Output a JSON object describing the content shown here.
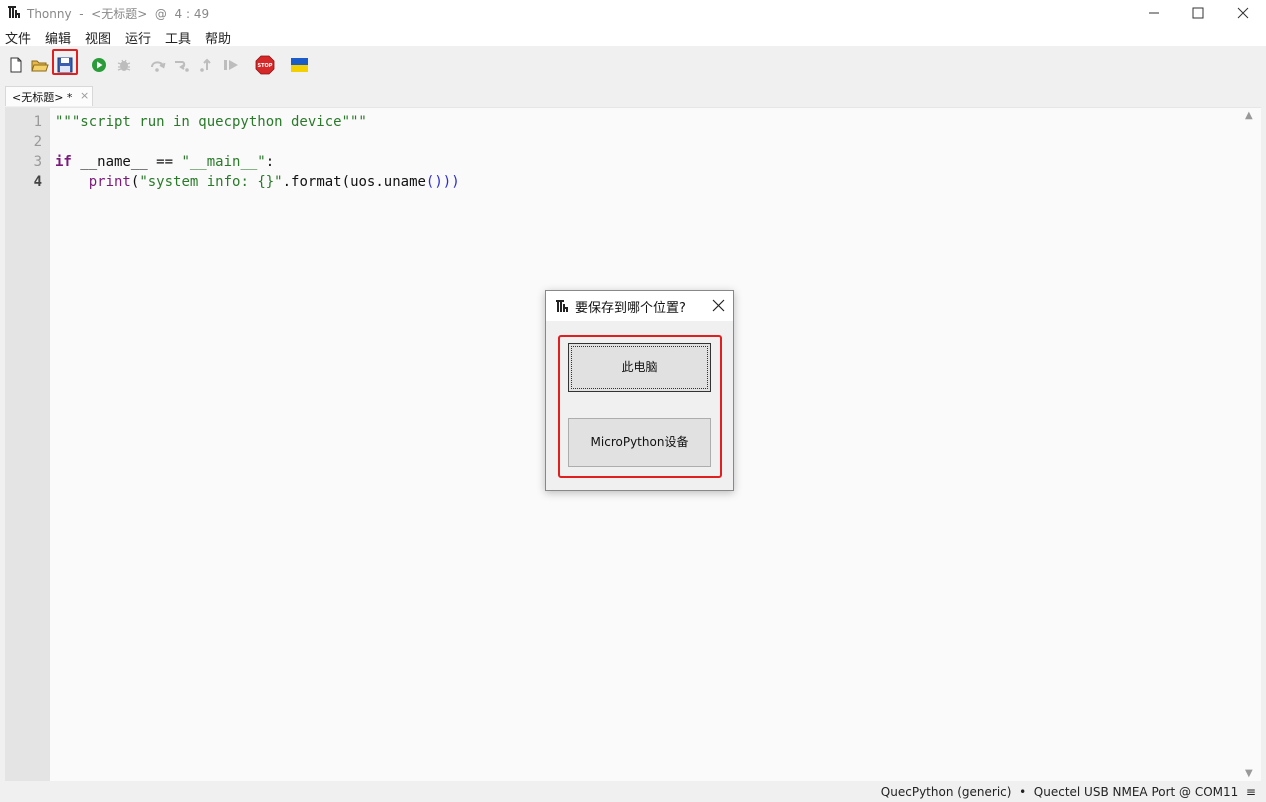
{
  "window": {
    "title": "Thonny  -  <无标题>  @  4 : 49"
  },
  "menu": [
    "文件",
    "编辑",
    "视图",
    "运行",
    "工具",
    "帮助"
  ],
  "toolbar": {
    "icons": [
      "new-file-icon",
      "open-file-icon",
      "save-file-icon",
      "run-icon",
      "debug-icon",
      "step-over-icon",
      "step-into-icon",
      "step-out-icon",
      "resume-icon",
      "stop-icon",
      "ukraine-flag-icon"
    ],
    "colors": {
      "run": "#2a9d3a",
      "stop": "#d62828",
      "highlight": "#e02020"
    }
  },
  "tab": {
    "label": "<无标题> *",
    "close": "×"
  },
  "editor": {
    "line_numbers": [
      "1",
      "2",
      "3",
      "4"
    ],
    "lines": [
      "\"\"\"script run in quecpython device\"\"\"",
      "",
      "if __name__ == \"__main__\":",
      "    print(\"system info: {}\".format(uos.uname()))"
    ],
    "tokens": {
      "l1": "\"\"\"script run in quecpython device\"\"\"",
      "l3_kw": "if",
      "l3_mid": " __name__ == ",
      "l3_str": "\"__main__\"",
      "l3_end": ":",
      "l4_indent": "    ",
      "l4_fn": "print",
      "l4_p1": "(",
      "l4_str": "\"system info: {}\"",
      "l4_mid": ".format",
      "l4_p2": "(",
      "l4_mid2": "uos.uname",
      "l4_p3": "()",
      "l4_p4": ")",
      "l4_p5": ")"
    }
  },
  "dialog": {
    "title": "要保存到哪个位置?",
    "options": [
      "此电脑",
      "MicroPython设备"
    ]
  },
  "statusbar": {
    "text": "QuecPython (generic)  •  Quectel USB NMEA Port @ COM11  ≡"
  }
}
